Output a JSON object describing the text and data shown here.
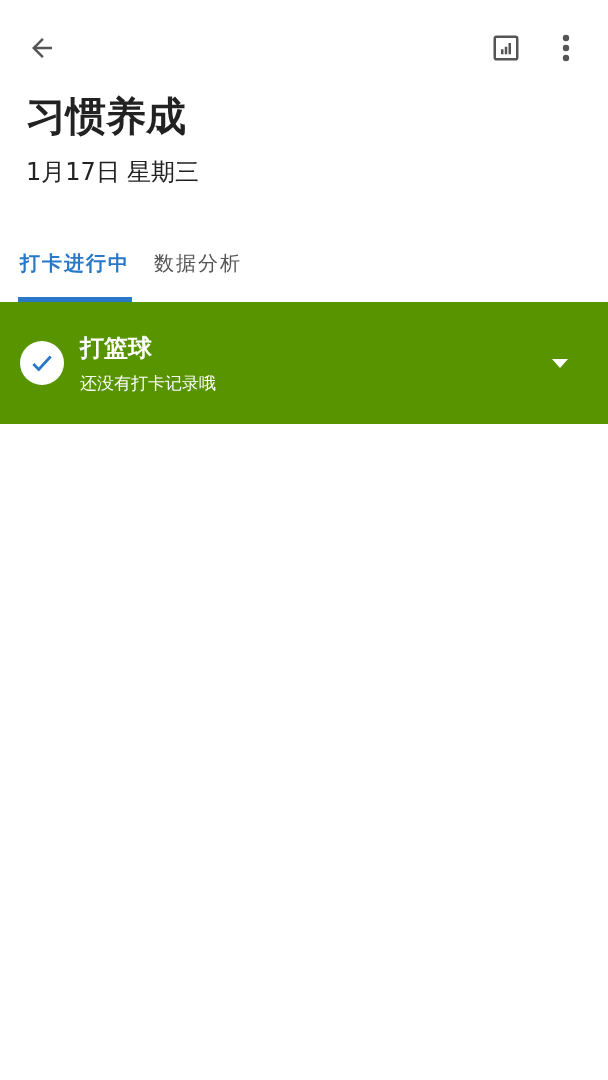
{
  "header": {
    "title": "习惯养成",
    "date": "1月17日 星期三"
  },
  "tabs": [
    {
      "label": "打卡进行中",
      "selected": true
    },
    {
      "label": "数据分析",
      "selected": false
    }
  ],
  "habits": [
    {
      "name": "打篮球",
      "note": "还没有打卡记录哦",
      "checked": true,
      "color": "#589400"
    }
  ]
}
